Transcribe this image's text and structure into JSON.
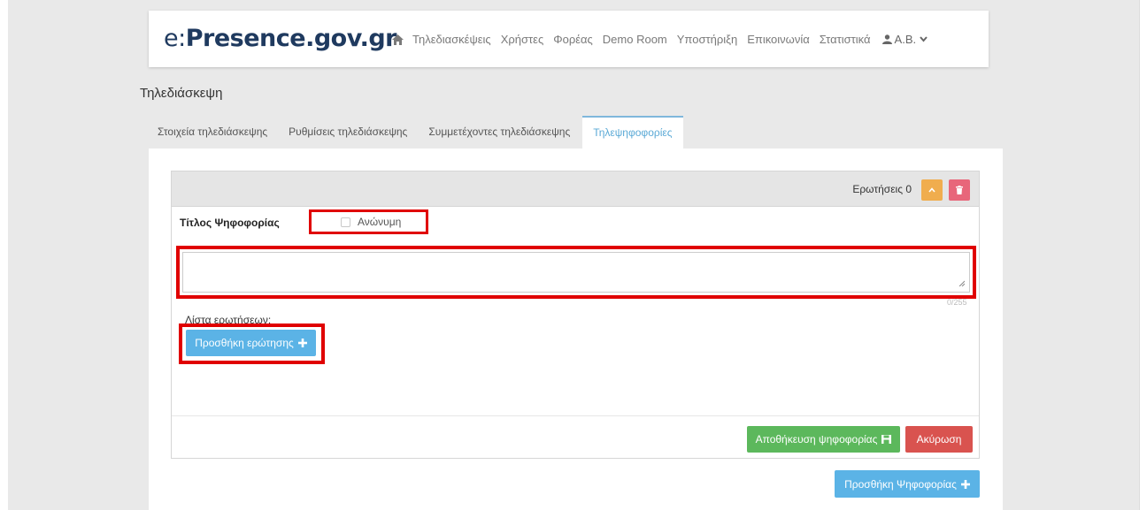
{
  "navbar": {
    "logo_prefix": "e:",
    "logo_name": "Presence",
    "logo_suffix": ".gov.gr",
    "items": [
      "Τηλεδιασκέψεις",
      "Χρήστες",
      "Φορέας",
      "Demo Room",
      "Υποστήριξη",
      "Επικοινωνία",
      "Στατιστικά"
    ],
    "user_label": "Α.Β."
  },
  "page": {
    "title": "Τηλεδιάσκεψη"
  },
  "tabs": [
    {
      "label": "Στοιχεία τηλεδιάσκεψης",
      "active": false
    },
    {
      "label": "Ρυθμίσεις τηλεδιάσκεψης",
      "active": false
    },
    {
      "label": "Συμμετέχοντες τηλεδιάσκεψης",
      "active": false
    },
    {
      "label": "Τηλεψηφοφορίες",
      "active": true
    }
  ],
  "poll": {
    "questions_count_label": "Ερωτήσεις 0",
    "title_label": "Τίτλος Ψηφοφορίας",
    "anonymous_label": "Ανώνυμη",
    "anonymous_checked": false,
    "title_value": "",
    "char_counter": "0/255",
    "questions_list_label": "Λίστα ερωτήσεων:",
    "add_question_label": "Προσθήκη ερώτησης",
    "save_label": "Αποθήκευση ψηφοφορίας",
    "cancel_label": "Ακύρωση"
  },
  "add_poll_label": "Προσθήκη Ψηφοφορίας",
  "colors": {
    "primary": "#5bb3e6",
    "success": "#5cb85c",
    "danger": "#d9534f",
    "warning": "#f0ad4e",
    "highlight": "#e00000"
  }
}
